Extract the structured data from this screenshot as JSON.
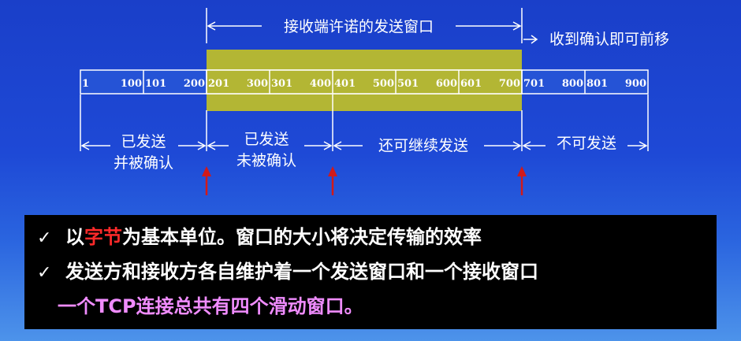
{
  "diagram": {
    "top_label": "接收端许诺的发送窗口",
    "right_label": "收到确认即可前移",
    "seq_numbers": [
      "1",
      "100",
      "101",
      "200",
      "201",
      "300",
      "301",
      "400",
      "401",
      "500",
      "501",
      "600",
      "601",
      "700",
      "701",
      "800",
      "801",
      "900"
    ],
    "segments": [
      {
        "text": "已发送",
        "text2": "并被确认"
      },
      {
        "text": "已发送",
        "text2": "未被确认"
      },
      {
        "text": "还可继续发送",
        "text2": ""
      },
      {
        "text": "不可发送",
        "text2": ""
      }
    ],
    "window_color": "#b3b634"
  },
  "notes": {
    "check": "✓",
    "line1_pre": "以",
    "line1_highlight": "字节",
    "line1_post": "为基本单位。窗口的大小将决定传输的效率",
    "line2": "发送方和接收方各自维护着一个发送窗口和一个接收窗口",
    "line3": "一个TCP连接总共有四个滑动窗口。"
  }
}
